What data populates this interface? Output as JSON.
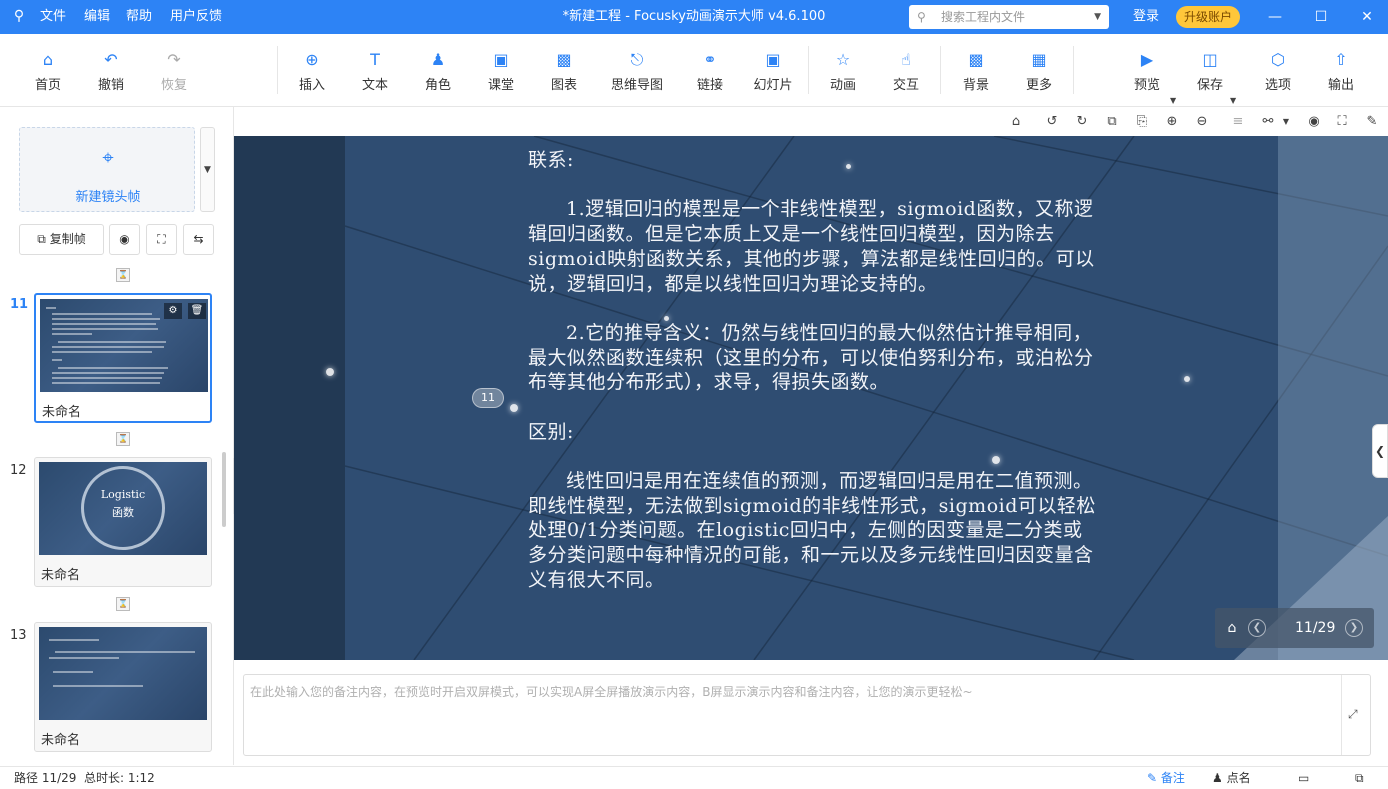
{
  "titlebar": {
    "logo_glyph": "⚲",
    "menus": [
      "文件",
      "编辑",
      "帮助",
      "用户反馈"
    ],
    "title": "*新建工程 - Focusky动画演示大师  v4.6.100",
    "search_placeholder": "搜索工程内文件",
    "login": "登录",
    "upgrade": "升级账户",
    "accent_color": "#2d83f5",
    "upgrade_color": "#ffc73a"
  },
  "toolbar": {
    "home": "首页",
    "undo": "撤销",
    "redo": "恢复",
    "insert": "插入",
    "text": "文本",
    "role": "角色",
    "classroom": "课堂",
    "chart": "图表",
    "mindmap": "思维导图",
    "link": "链接",
    "slideshow": "幻灯片",
    "animation": "动画",
    "interact": "交互",
    "background": "背景",
    "more": "更多",
    "preview": "预览",
    "save": "保存",
    "options": "选项",
    "export": "输出"
  },
  "sidebar": {
    "new_frame_label": "新建镜头帧",
    "copy_frame_label": "复制帧",
    "slides": [
      {
        "num": "11",
        "name": "未命名",
        "active": true
      },
      {
        "num": "12",
        "name": "未命名",
        "thumb_title_1": "Logistic",
        "thumb_title_2": "函数"
      },
      {
        "num": "13",
        "name": "未命名"
      }
    ]
  },
  "canvas": {
    "step_badge": "11",
    "paragraphs": [
      "联系:",
      "1.逻辑回归的模型是一个非线性模型，sigmoid函数，又称逻辑回归函数。但是它本质上又是一个线性回归模型，因为除去sigmoid映射函数关系，其他的步骤，算法都是线性回归的。可以说，逻辑回归，都是以线性回归为理论支持的。",
      "2.它的推导含义：仍然与线性回归的最大似然估计推导相同，最大似然函数连续积（这里的分布，可以使伯努利分布，或泊松分布等其他分布形式），求导，得损失函数。",
      "区别:",
      "线性回归是用在连续值的预测，而逻辑回归是用在二值预测。即线性模型，无法做到sigmoid的非线性形式，sigmoid可以轻松处理0/1分类问题。在logistic回归中，左侧的因变量是二分类或多分类问题中每种情况的可能，和一元以及多元线性回归因变量含义有很大不同。"
    ],
    "page_counter": "11/29"
  },
  "notes": {
    "placeholder": "在此处输入您的备注内容，在预览时开启双屏模式，可以实现A屏全屏播放演示内容，B屏显示演示内容和备注内容，让您的演示更轻松~"
  },
  "status": {
    "path": "路径 11/29",
    "duration": "总时长: 1:12",
    "notes_tab": "备注",
    "rollcall_tab": "点名"
  }
}
